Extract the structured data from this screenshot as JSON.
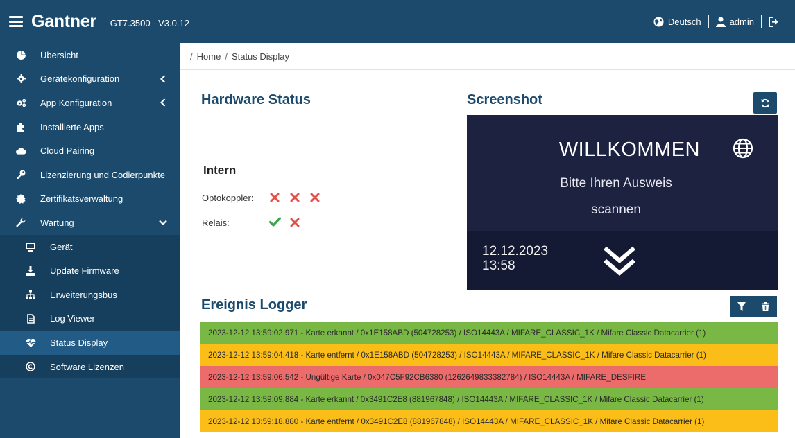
{
  "header": {
    "brand": "Gantner",
    "version": "GT7.3500 - V3.0.12",
    "language": "Deutsch",
    "user": "admin"
  },
  "sidebar": {
    "items": [
      {
        "label": "Übersicht",
        "icon": "pie-chart-icon"
      },
      {
        "label": "Gerätekonfiguration",
        "icon": "cog-icon"
      },
      {
        "label": "App Konfiguration",
        "icon": "cogs-icon"
      },
      {
        "label": "Installierte Apps",
        "icon": "puzzle-icon"
      },
      {
        "label": "Cloud Pairing",
        "icon": "cloud-icon"
      },
      {
        "label": "Lizenzierung und Codierpunkte",
        "icon": "key-icon"
      },
      {
        "label": "Zertifikatsverwaltung",
        "icon": "certificate-icon"
      },
      {
        "label": "Wartung",
        "icon": "wrench-icon"
      }
    ],
    "subitems": [
      {
        "label": "Gerät",
        "icon": "monitor-icon"
      },
      {
        "label": "Update Firmware",
        "icon": "download-icon"
      },
      {
        "label": "Erweiterungsbus",
        "icon": "sitemap-icon"
      },
      {
        "label": "Log Viewer",
        "icon": "file-text-icon"
      },
      {
        "label": "Status Display",
        "icon": "heartbeat-icon"
      },
      {
        "label": "Software Lizenzen",
        "icon": "copyright-icon"
      }
    ]
  },
  "breadcrumb": {
    "home": "Home",
    "current": "Status Display"
  },
  "hardware": {
    "title": "Hardware Status",
    "intern_title": "Intern",
    "optokoppler_label": "Optokoppler:",
    "optokoppler_states": [
      false,
      false,
      false
    ],
    "relais_label": "Relais:",
    "relais_states": [
      true,
      false
    ]
  },
  "screenshot": {
    "title": "Screenshot",
    "welcome": "WILLKOMMEN",
    "prompt_line1": "Bitte Ihren Ausweis",
    "prompt_line2": "scannen",
    "date": "12.12.2023",
    "time": "13:58"
  },
  "logger": {
    "title": "Ereignis Logger",
    "entries": [
      {
        "text": "2023-12-12 13:59:02.971 - Karte erkannt / 0x1E158ABD (504728253) / ISO14443A / MIFARE_CLASSIC_1K / Mifare Classic Datacarrier (1)",
        "status": "green"
      },
      {
        "text": "2023-12-12 13:59:04.418 - Karte entfernt / 0x1E158ABD (504728253) / ISO14443A / MIFARE_CLASSIC_1K / Mifare Classic Datacarrier (1)",
        "status": "orange"
      },
      {
        "text": "2023-12-12 13:59:06.542 - Ungültige Karte / 0x047C5F92CB6380 (1262649833382784) / ISO14443A / MIFARE_DESFIRE",
        "status": "red"
      },
      {
        "text": "2023-12-12 13:59:09.884 - Karte erkannt / 0x3491C2E8 (881967848) / ISO14443A / MIFARE_CLASSIC_1K / Mifare Classic Datacarrier (1)",
        "status": "green"
      },
      {
        "text": "2023-12-12 13:59:18.880 - Karte entfernt / 0x3491C2E8 (881967848) / ISO14443A / MIFARE_CLASSIC_1K / Mifare Classic Datacarrier (1)",
        "status": "orange"
      }
    ]
  },
  "colors": {
    "primary": "#1b4a6c",
    "ok": "#3aa64b",
    "error": "#e2504a",
    "log_green": "#79b845",
    "log_orange": "#fbbe18",
    "log_red": "#ec6b6b"
  }
}
